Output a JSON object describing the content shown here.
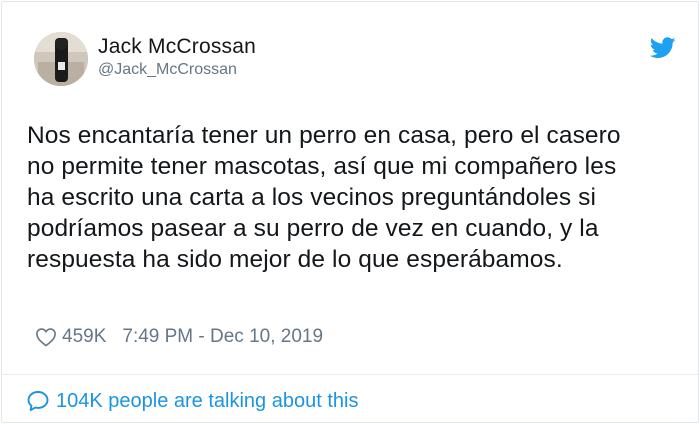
{
  "tweet": {
    "author_name": "Jack McCrossan",
    "author_handle": "@Jack_McCrossan",
    "text_lines": [
      "Nos encantaría tener un perro en casa, pero el casero",
      "no permite tener mascotas, así que mi compañero les",
      "ha escrito una carta a los vecinos preguntándoles si",
      "podríamos pasear a su perro de vez en cuando, y la",
      "respuesta ha sido mejor de lo que esperábamos."
    ],
    "likes": "459K",
    "timestamp": "7:49 PM - Dec 10, 2019"
  },
  "footer": {
    "talking_text": "104K people are talking about this"
  },
  "colors": {
    "brand_blue": "#1da1f2",
    "link_blue": "#1b95e0",
    "muted_gray": "#657786",
    "text_dark": "#14171a"
  },
  "icons": {
    "brand": "twitter-bird-icon",
    "like": "heart-outline-icon",
    "conversation": "speech-bubble-icon"
  }
}
